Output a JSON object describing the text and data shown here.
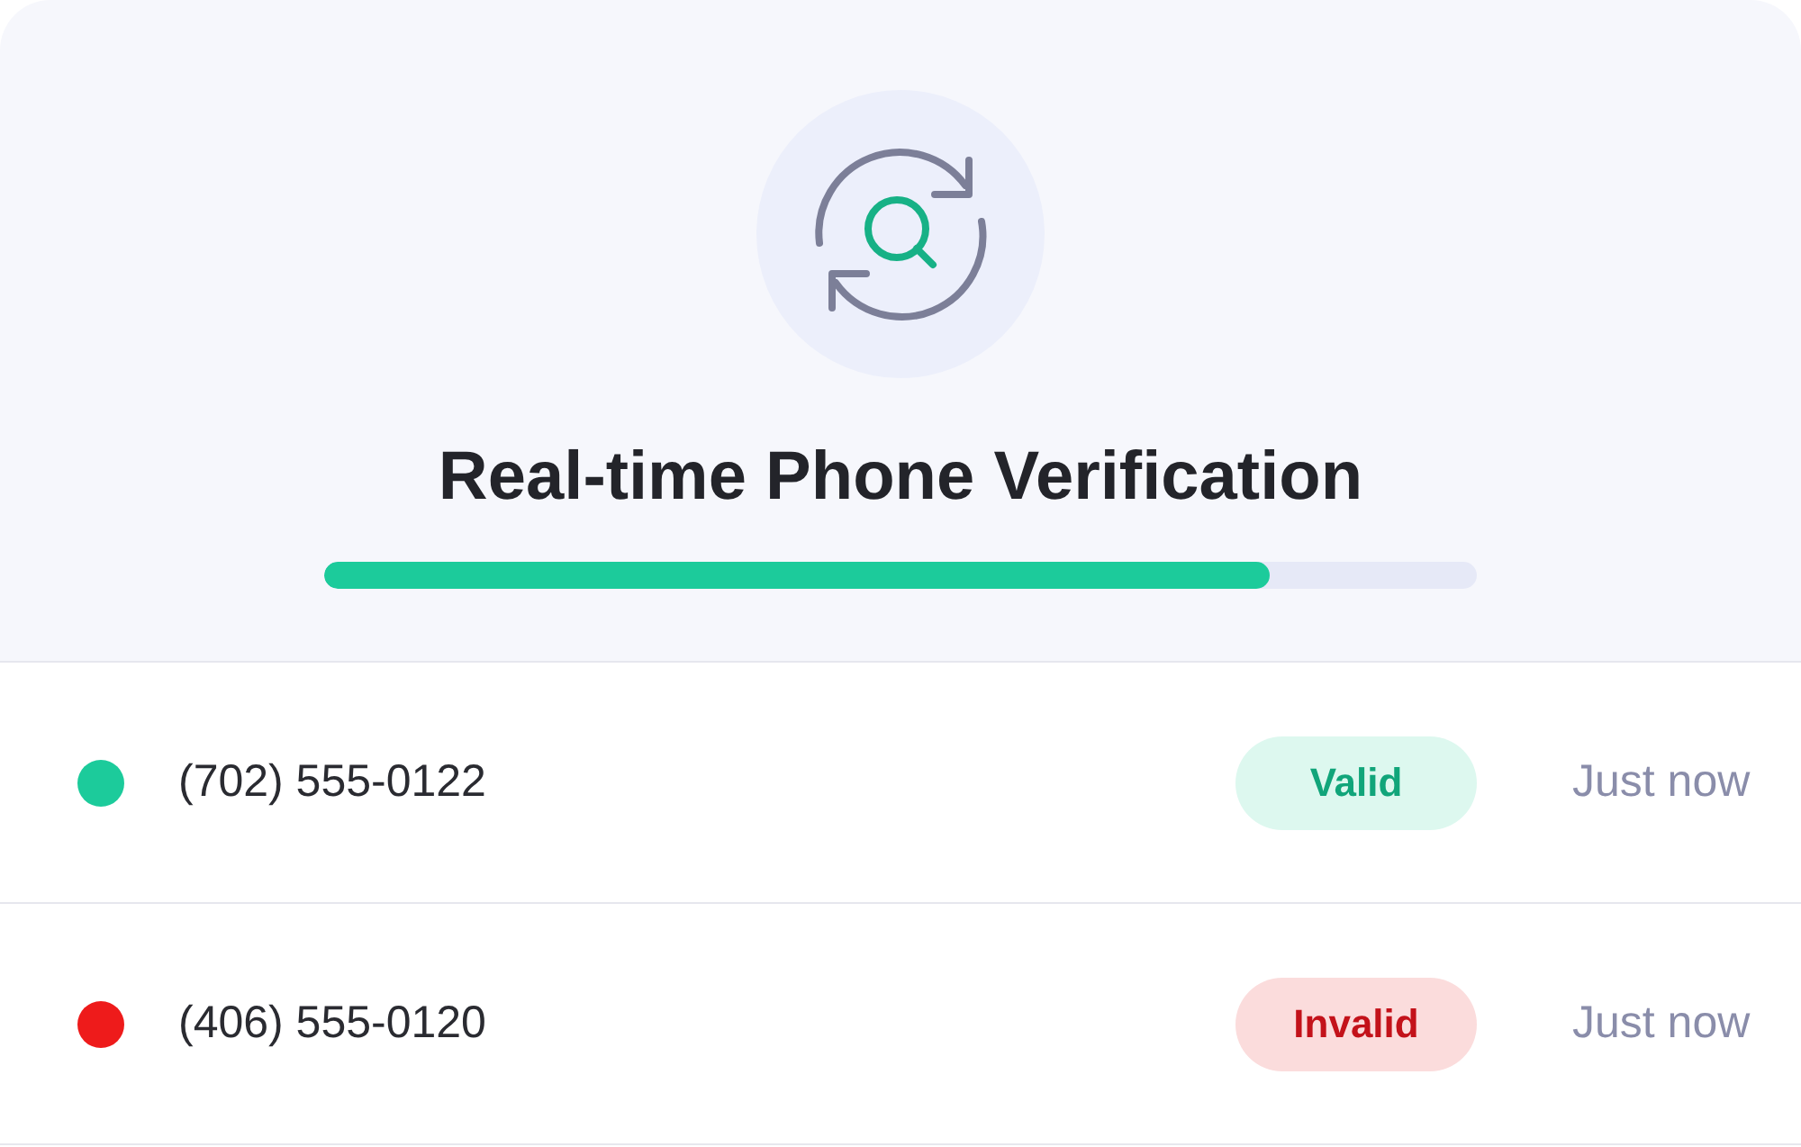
{
  "title": "Real-time Phone Verification",
  "progress": {
    "level": 0.82
  },
  "results": [
    {
      "phone": "(702) 555-0122",
      "color": "#1ccb9b",
      "status": {
        "kind": "valid",
        "label": "Valid"
      },
      "time": "Just now"
    },
    {
      "phone": "(406) 555-0120",
      "color": "#ee1b1b",
      "status": {
        "kind": "invalid",
        "label": "Invalid"
      },
      "time": "Just now"
    }
  ]
}
